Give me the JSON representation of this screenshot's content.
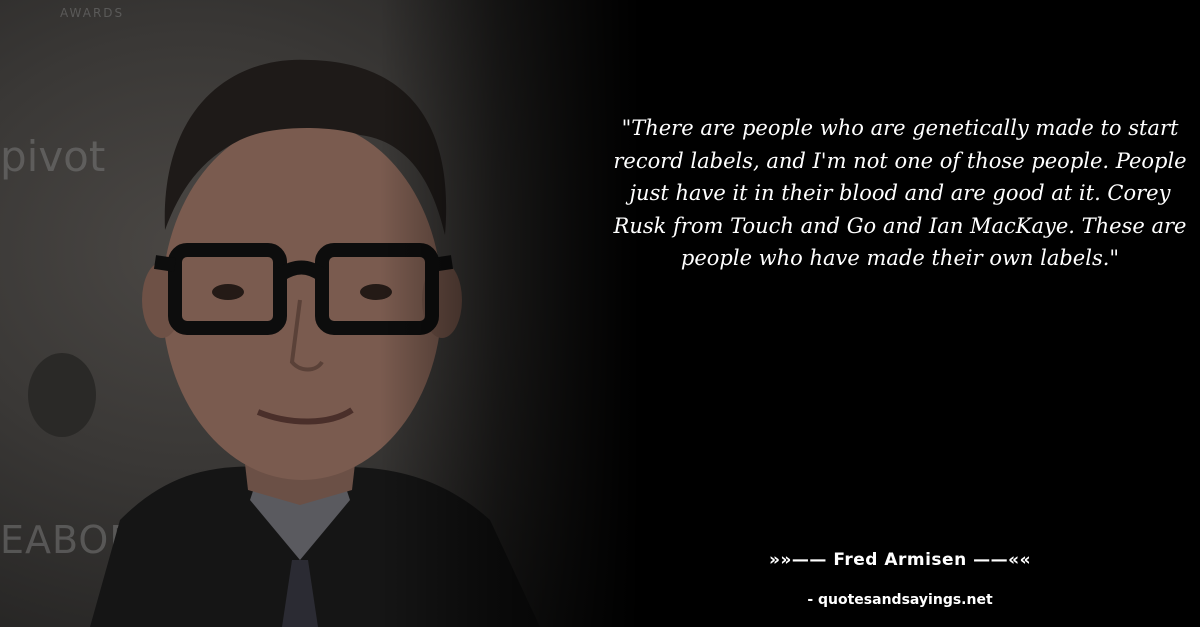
{
  "photo": {
    "backdrop": {
      "awards": "AWARDS",
      "pivot": "pivot",
      "peabody": "EABODY"
    }
  },
  "quote": {
    "text": "\"There are people who are genetically made to start record labels, and I'm not one of those people. People just have it in their blood and are good at it. Corey Rusk from Touch and Go and Ian MacKaye. These are people who have made their own labels.\""
  },
  "author": {
    "label": "»»—— Fred Armisen ——««"
  },
  "site": {
    "label": "- quotesandsayings.net"
  },
  "colors": {
    "background": "#000000",
    "text": "#ffffff"
  }
}
